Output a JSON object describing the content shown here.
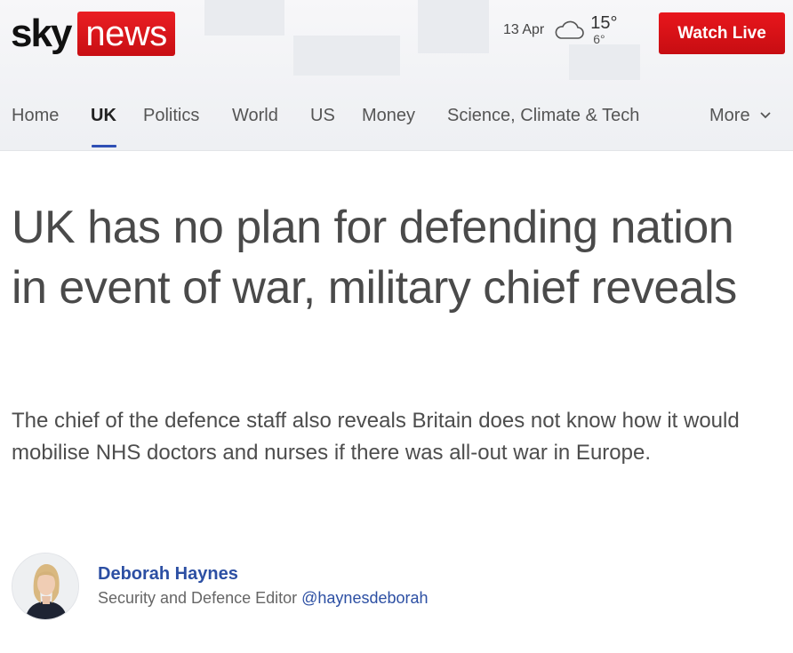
{
  "brand": {
    "logo_part1": "sky",
    "logo_part2": "news",
    "red": "#e01b22",
    "blue": "#2c4fa3"
  },
  "weather": {
    "date": "13 Apr",
    "icon": "cloud-icon",
    "high": "15°",
    "low": "6°"
  },
  "header": {
    "watch_live_label": "Watch Live"
  },
  "nav": {
    "items": [
      {
        "label": "Home"
      },
      {
        "label": "UK",
        "active": true
      },
      {
        "label": "Politics"
      },
      {
        "label": "World"
      },
      {
        "label": "US"
      },
      {
        "label": "Money"
      },
      {
        "label": "Science, Climate & Tech"
      }
    ],
    "more_label": "More",
    "more_icon": "chevron-down-icon"
  },
  "article": {
    "headline": "UK has no plan for defending nation in event of war, military chief reveals",
    "standfirst": "The chief of the defence staff also reveals Britain does not know how it would mobilise NHS doctors and nurses if there was all-out war in Europe."
  },
  "author": {
    "name": "Deborah Haynes",
    "role": "Security and Defence Editor",
    "handle": "@haynesdeborah"
  }
}
